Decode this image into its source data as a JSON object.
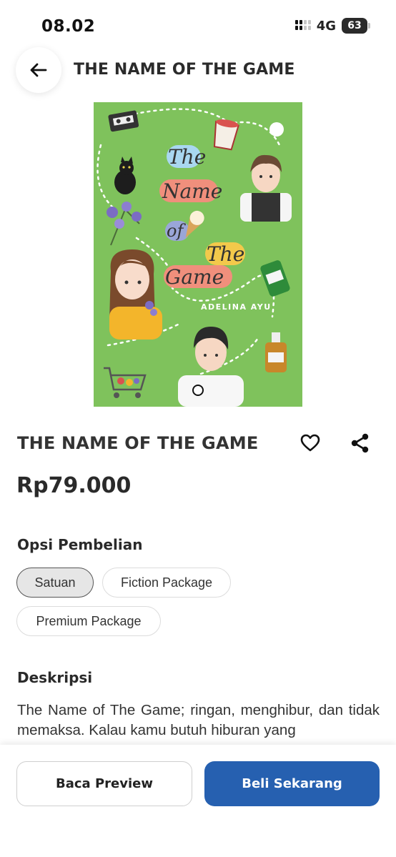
{
  "status_bar": {
    "time": "08.02",
    "network": "4G",
    "battery": "63"
  },
  "header": {
    "title": "THE NAME OF THE GAME"
  },
  "cover": {
    "title_words": [
      "The",
      "Name",
      "of",
      "The",
      "Game"
    ],
    "author": "ADELINA AYU"
  },
  "product": {
    "title": "THE NAME OF THE GAME",
    "price": "Rp79.000"
  },
  "purchase_options": {
    "heading": "Opsi Pembelian",
    "options": [
      "Satuan",
      "Fiction Package",
      "Premium Package"
    ],
    "selected": "Satuan"
  },
  "description": {
    "heading": "Deskripsi",
    "text": "The Name of The Game; ringan, menghibur, dan tidak memaksa. Kalau kamu butuh hiburan yang"
  },
  "actions": {
    "preview_label": "Baca Preview",
    "buy_label": "Beli Sekarang"
  },
  "colors": {
    "accent": "#2660b0",
    "cover_green": "#7fc25c"
  }
}
